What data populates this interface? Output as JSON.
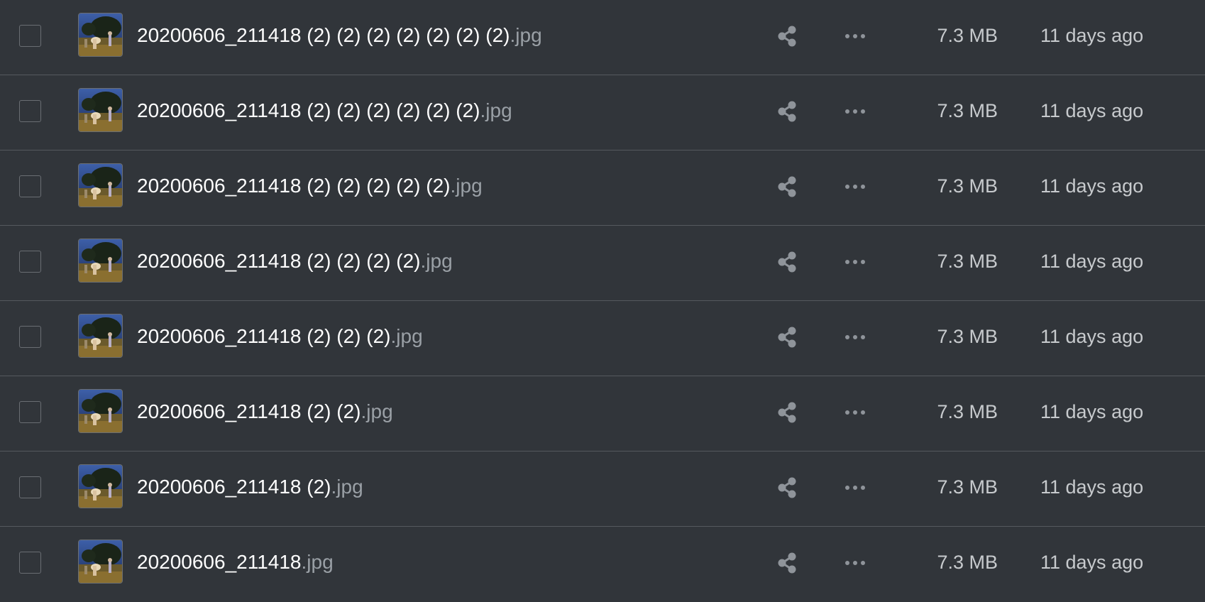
{
  "colors": {
    "background": "#31353a",
    "divider": "#55595e",
    "filename": "#ffffff",
    "extension": "#9aa0a6",
    "meta_text": "#c7cacd",
    "icon": "#8f949a"
  },
  "icons": {
    "share": "share-icon",
    "more": "more-horizontal-icon",
    "checkbox": "checkbox-unchecked"
  },
  "files": [
    {
      "basename": "20200606_211418 (2) (2) (2) (2) (2) (2) (2)",
      "extension": ".jpg",
      "size": "7.3 MB",
      "modified": "11 days ago"
    },
    {
      "basename": "20200606_211418 (2) (2) (2) (2) (2) (2)",
      "extension": ".jpg",
      "size": "7.3 MB",
      "modified": "11 days ago"
    },
    {
      "basename": "20200606_211418 (2) (2) (2) (2) (2)",
      "extension": ".jpg",
      "size": "7.3 MB",
      "modified": "11 days ago"
    },
    {
      "basename": "20200606_211418 (2) (2) (2) (2)",
      "extension": ".jpg",
      "size": "7.3 MB",
      "modified": "11 days ago"
    },
    {
      "basename": "20200606_211418 (2) (2) (2)",
      "extension": ".jpg",
      "size": "7.3 MB",
      "modified": "11 days ago"
    },
    {
      "basename": "20200606_211418 (2) (2)",
      "extension": ".jpg",
      "size": "7.3 MB",
      "modified": "11 days ago"
    },
    {
      "basename": "20200606_211418 (2)",
      "extension": ".jpg",
      "size": "7.3 MB",
      "modified": "11 days ago"
    },
    {
      "basename": "20200606_211418",
      "extension": ".jpg",
      "size": "7.3 MB",
      "modified": "11 days ago"
    }
  ]
}
